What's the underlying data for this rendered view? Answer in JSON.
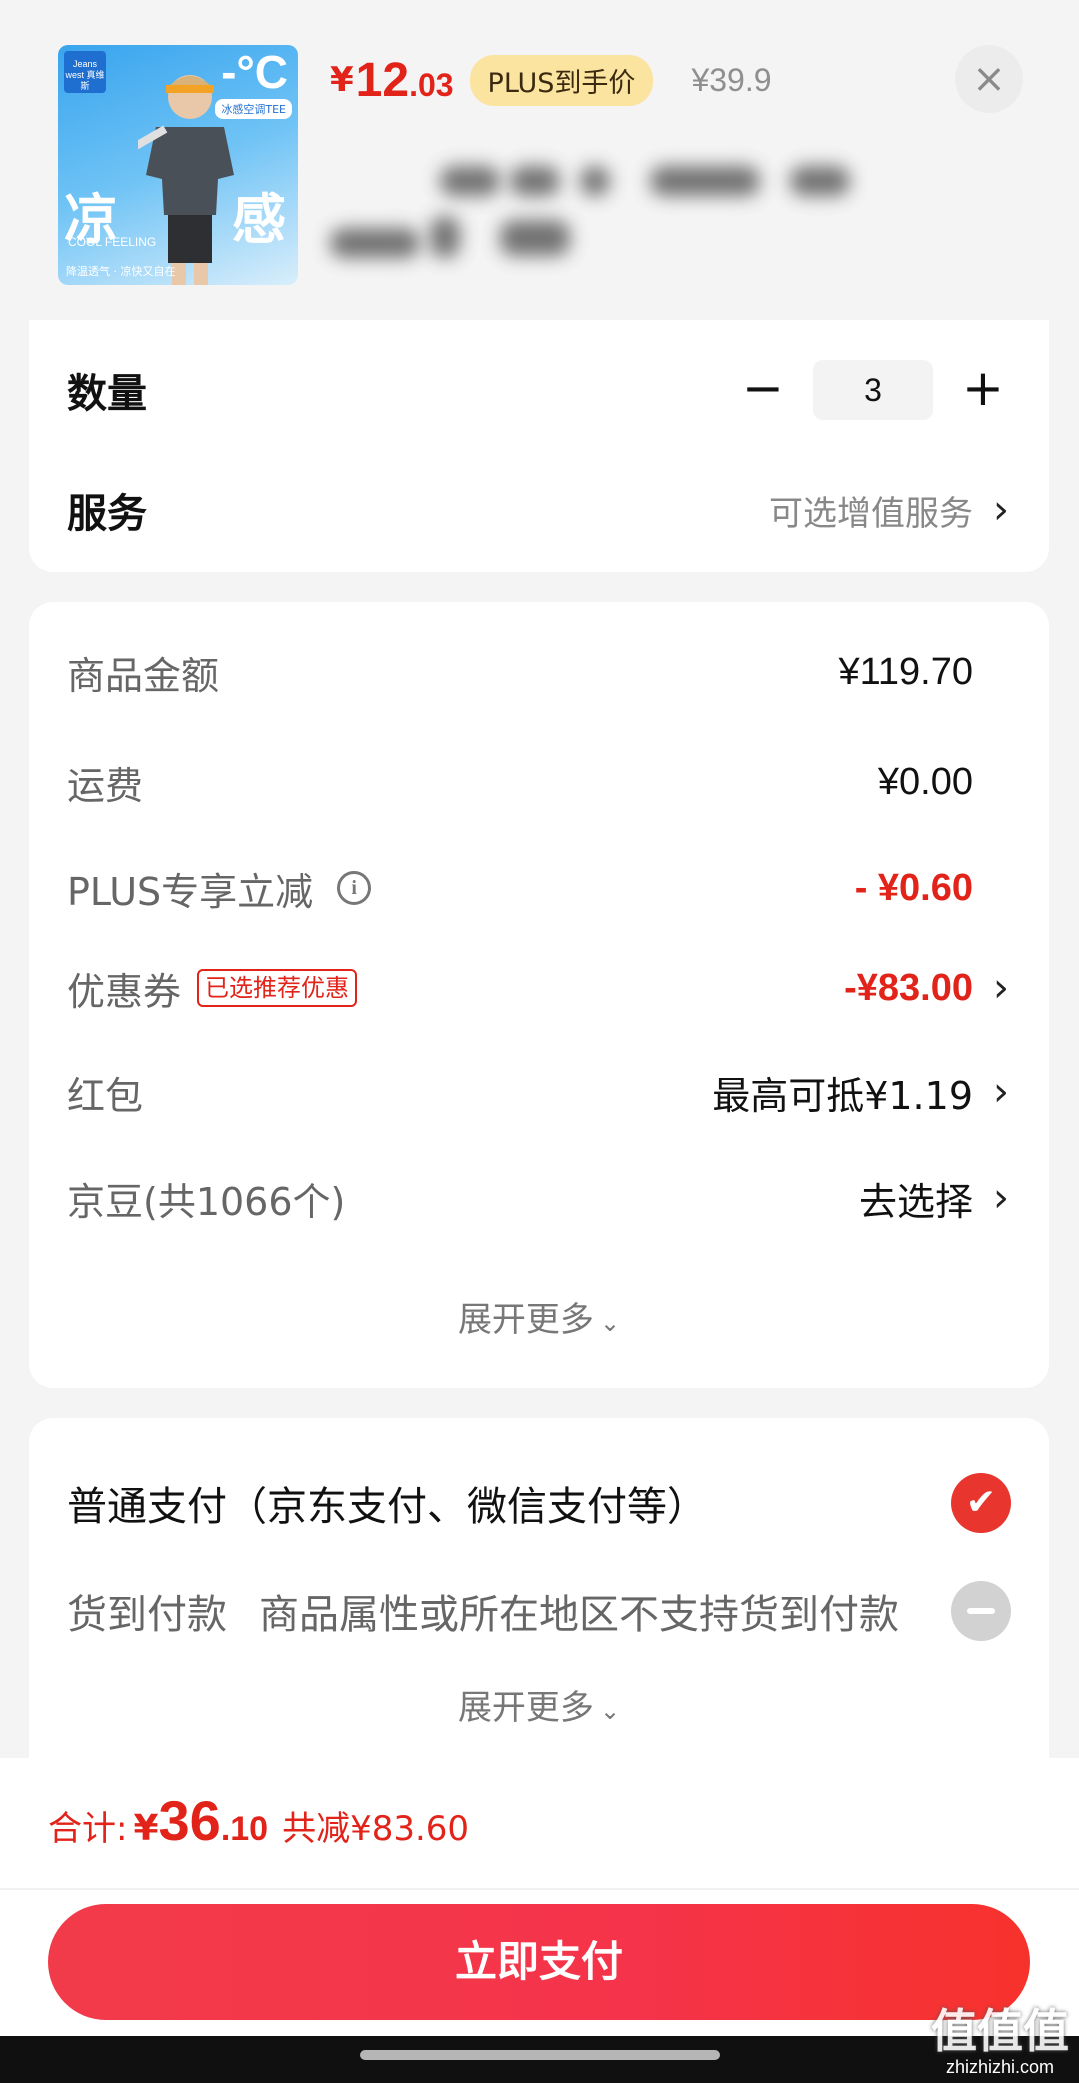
{
  "product": {
    "image_alt": "kids cooling t-shirt",
    "image_texts": {
      "brand": "Jeans west 真维斯",
      "temp": "-°C",
      "tag": "冰感空调TEE",
      "big_left": "凉",
      "big_right": "感",
      "cool_feeling": "COOL FEELING",
      "footer": "降温透气 · 凉快又自在"
    },
    "price_currency": "¥",
    "price_int": "12",
    "price_dec": ".03",
    "plus_badge": "PLUS到手价",
    "original_price": "¥39.9",
    "close_icon": "×"
  },
  "quantity": {
    "label": "数量",
    "minus": "−",
    "value": "3",
    "plus": "+"
  },
  "service": {
    "label": "服务",
    "value": "可选增值服务",
    "chevron": "›"
  },
  "summary": {
    "items": [
      {
        "label": "商品金额",
        "value": "¥119.70"
      },
      {
        "label": "运费",
        "value": "¥0.00"
      },
      {
        "label": "PLUS专享立减",
        "info_icon": "i",
        "value": "- ¥0.60"
      },
      {
        "label": "优惠券",
        "tag": "已选推荐优惠",
        "value": "-¥83.00"
      },
      {
        "label": "红包",
        "value": "最高可抵¥1.19"
      },
      {
        "label": "京豆(共1066个)",
        "value": "去选择"
      }
    ],
    "expand_label": "展开更多",
    "expand_chevron": "⌄"
  },
  "payment": {
    "options": [
      {
        "label": "普通支付（京东支付、微信支付等）",
        "selected": true
      },
      {
        "label": "货到付款",
        "note": "商品属性或所在地区不支持货到付款",
        "disabled": true
      }
    ],
    "expand_label": "展开更多",
    "expand_chevron": "⌄"
  },
  "footer": {
    "total_label": "合计:",
    "total_currency": "¥",
    "total_int": "36",
    "total_dec": ".10",
    "total_saved": "共减¥83.60",
    "pay_button": "立即支付"
  },
  "watermark": {
    "logo": "值值值",
    "url": "zhizhizhi.com"
  },
  "colors": {
    "accent_red": "#e2231a",
    "plus_badge_bg": "#fbe3a0",
    "pay_button": "#f23b4a",
    "check_selected": "#e8362f",
    "check_disabled": "#d2d2d2"
  }
}
